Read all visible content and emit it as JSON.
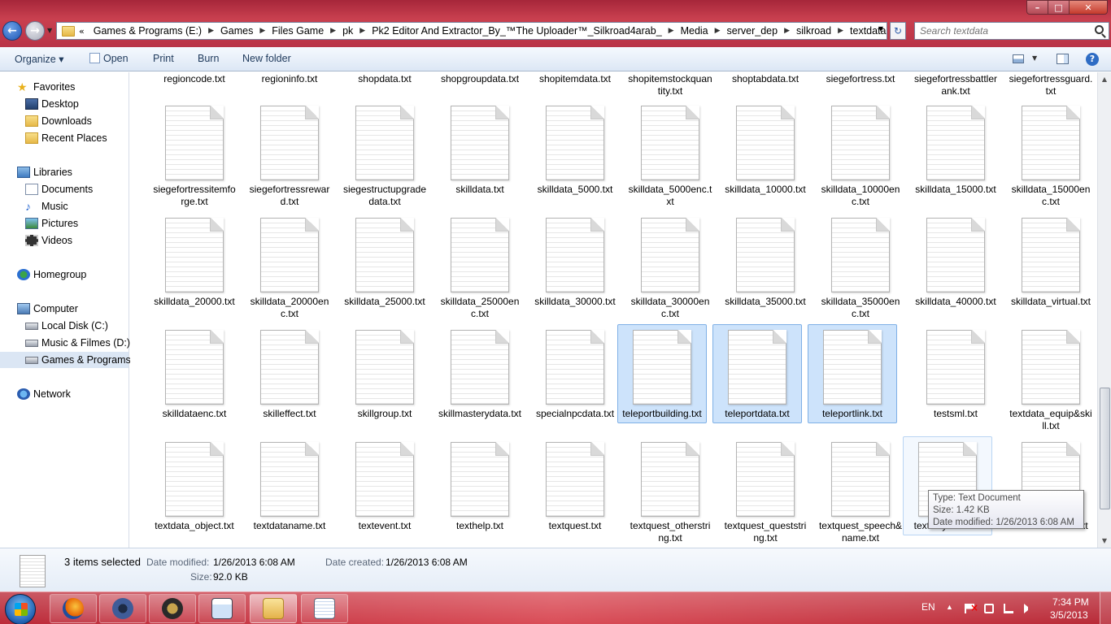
{
  "window": {
    "address": {
      "lead": "«",
      "crumbs": [
        "Games & Programs (E:)",
        "Games",
        "Files Game",
        "pk",
        "Pk2 Editor And Extractor_By_™The Uploader™_Silkroad4arab_",
        "Media",
        "server_dep",
        "silkroad",
        "textdata"
      ]
    },
    "search_placeholder": "Search textdata",
    "controls": {
      "min": "–",
      "max": "□",
      "close": "✕"
    }
  },
  "toolbar": {
    "organize": "Organize ▾",
    "open": "Open",
    "print": "Print",
    "burn": "Burn",
    "new_folder": "New folder",
    "help": "?"
  },
  "nav": {
    "favorites": "Favorites",
    "desktop": "Desktop",
    "downloads": "Downloads",
    "recent": "Recent Places",
    "libraries": "Libraries",
    "documents": "Documents",
    "music": "Music",
    "pictures": "Pictures",
    "videos": "Videos",
    "homegroup": "Homegroup",
    "computer": "Computer",
    "local_disk": "Local Disk (C:)",
    "music_films": "Music & Filmes (D:)",
    "games_programs": "Games & Programs",
    "network": "Network"
  },
  "files": {
    "top_row": [
      "regioncode.txt",
      "regioninfo.txt",
      "shopdata.txt",
      "shopgroupdata.txt",
      "shopitemdata.txt",
      "shopitemstockquantity.txt",
      "shoptabdata.txt",
      "siegefortress.txt",
      "siegefortressbattlerank.txt",
      "siegefortressguard.txt"
    ],
    "row1": [
      "siegefortressitemforge.txt",
      "siegefortressreward.txt",
      "siegestructupgradedata.txt",
      "skilldata.txt",
      "skilldata_5000.txt",
      "skilldata_5000enc.txt",
      "skilldata_10000.txt",
      "skilldata_10000enc.txt",
      "skilldata_15000.txt",
      "skilldata_15000enc.txt"
    ],
    "row2": [
      "skilldata_20000.txt",
      "skilldata_20000enc.txt",
      "skilldata_25000.txt",
      "skilldata_25000enc.txt",
      "skilldata_30000.txt",
      "skilldata_30000enc.txt",
      "skilldata_35000.txt",
      "skilldata_35000enc.txt",
      "skilldata_40000.txt",
      "skilldata_virtual.txt"
    ],
    "row3": [
      "skilldataenc.txt",
      "skilleffect.txt",
      "skillgroup.txt",
      "skillmasterydata.txt",
      "specialnpcdata.txt",
      "teleportbuilding.txt",
      "teleportdata.txt",
      "teleportlink.txt",
      "testsml.txt",
      "textdata_equip&skill.txt"
    ],
    "row4": [
      "textdata_object.txt",
      "textdataname.txt",
      "textevent.txt",
      "texthelp.txt",
      "textquest.txt",
      "textquest_otherstring.txt",
      "textquest_queststring.txt",
      "textquest_speech&name.txt",
      "textuisystem.txt",
      "textzonename.txt"
    ]
  },
  "tooltip": {
    "type": "Type: Text Document",
    "size": "Size: 1.42 KB",
    "modified": "Date modified: 1/26/2013 6:08 AM"
  },
  "details": {
    "selected": "3 items selected",
    "modified_label": "Date modified:",
    "modified_value": "1/26/2013 6:08 AM",
    "created_label": "Date created:",
    "created_value": "1/26/2013 6:08 AM",
    "size_label": "Size:",
    "size_value": "92.0 KB"
  },
  "taskbar": {
    "language": "EN",
    "time": "7:34 PM",
    "date": "3/5/2013"
  },
  "colors": {
    "accent": "#b93347",
    "selection": "#cde3fb",
    "selection_border": "#7fb0e6"
  }
}
